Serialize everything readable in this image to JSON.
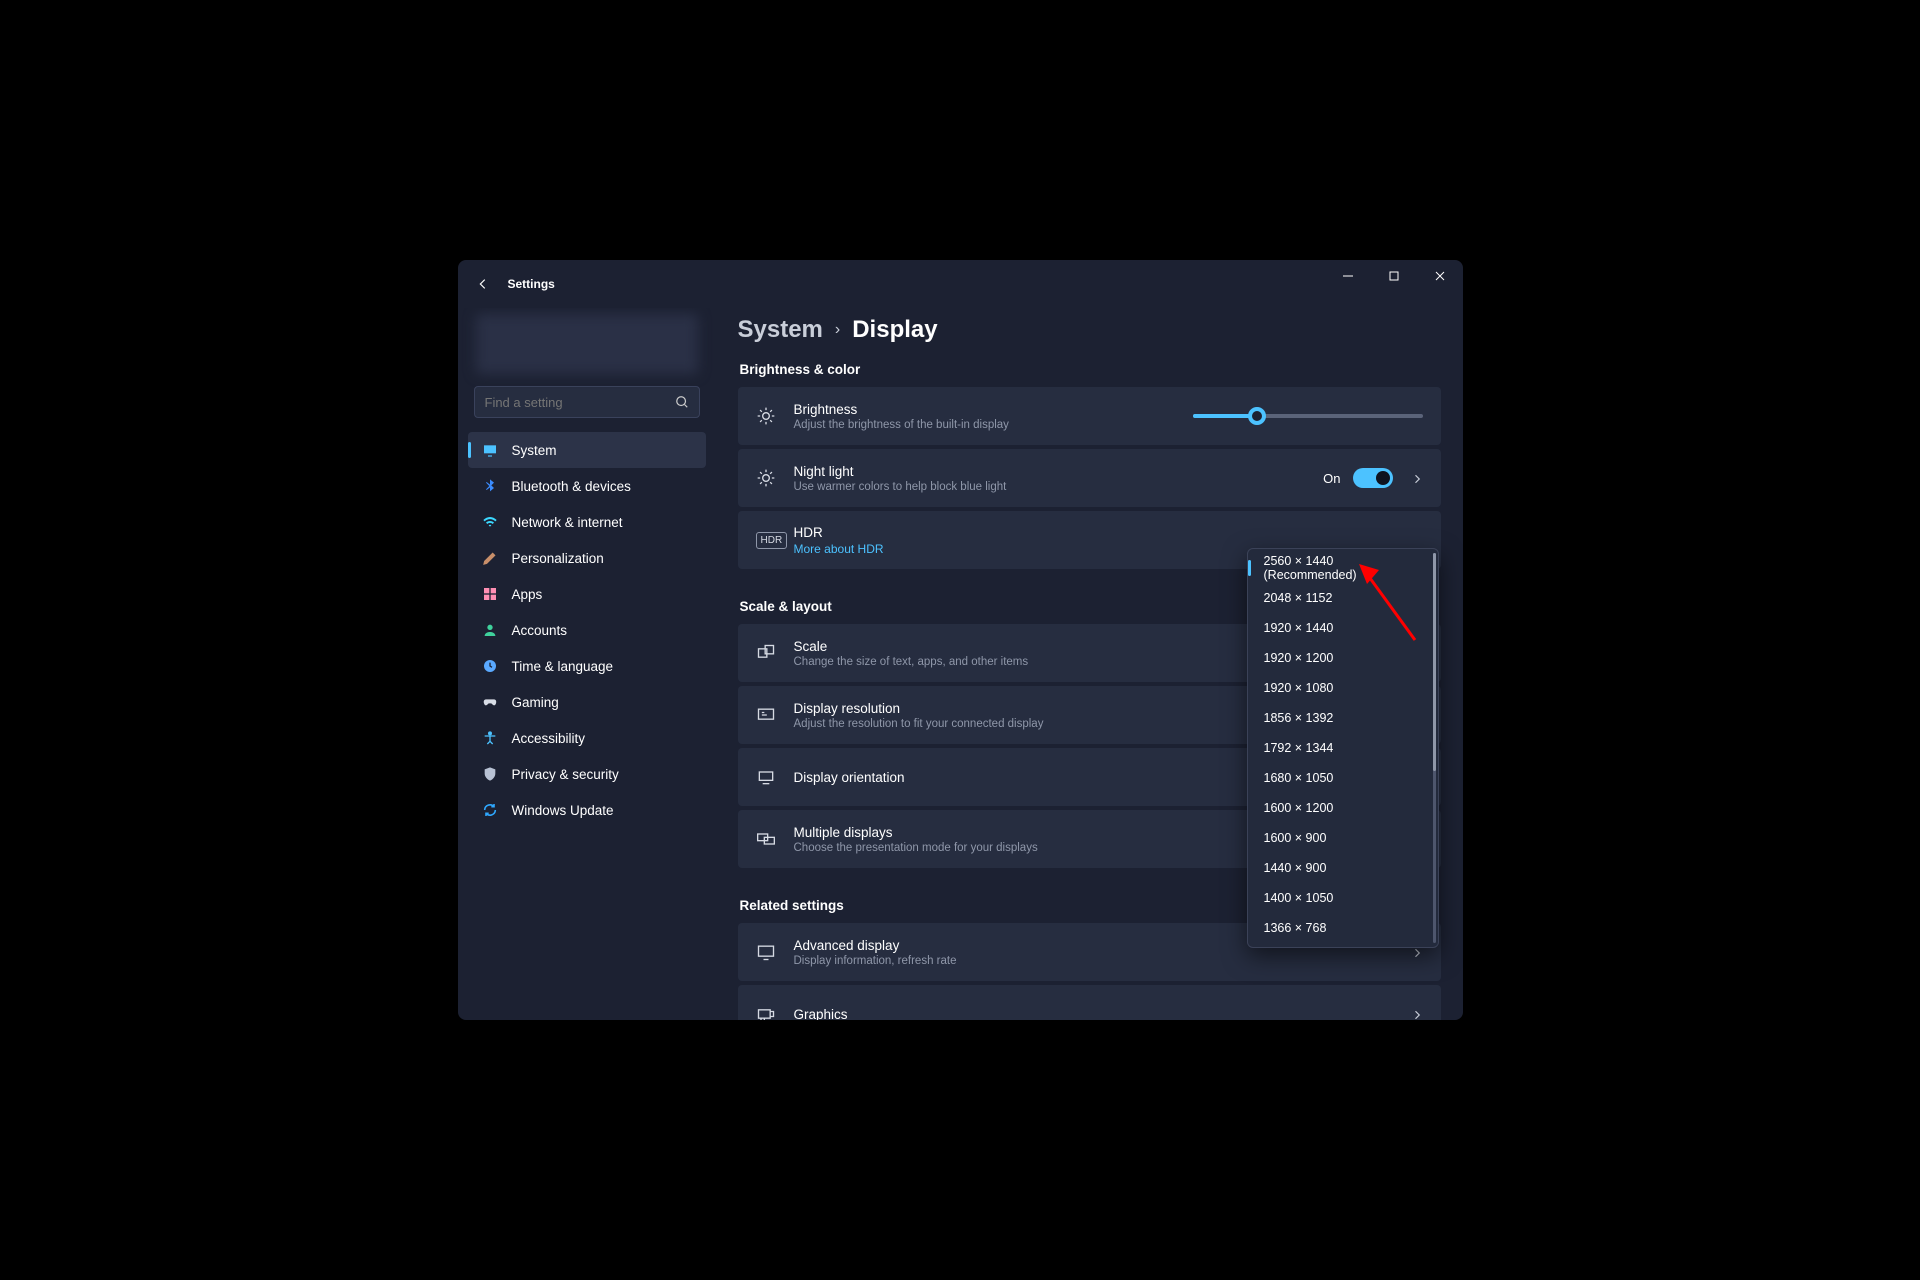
{
  "titlebar": {
    "app_name": "Settings"
  },
  "search": {
    "placeholder": "Find a setting"
  },
  "sidebar": [
    {
      "label": "System",
      "active": true,
      "color": "#4cc2ff"
    },
    {
      "label": "Bluetooth & devices",
      "color": "#3b8cff"
    },
    {
      "label": "Network & internet",
      "color": "#3bd8ff"
    },
    {
      "label": "Personalization",
      "color": "#c88f6a"
    },
    {
      "label": "Apps",
      "color": "#ff8fb3"
    },
    {
      "label": "Accounts",
      "color": "#3fd19c"
    },
    {
      "label": "Time & language",
      "color": "#5aa9ff"
    },
    {
      "label": "Gaming",
      "color": "#d8dde6"
    },
    {
      "label": "Accessibility",
      "color": "#4cc2ff"
    },
    {
      "label": "Privacy & security",
      "color": "#b8c2d4"
    },
    {
      "label": "Windows Update",
      "color": "#2fa8ff"
    }
  ],
  "breadcrumb": {
    "level1": "System",
    "level2": "Display"
  },
  "sections": {
    "brightness_color": "Brightness & color",
    "scale_layout": "Scale & layout",
    "related": "Related settings"
  },
  "cards": {
    "brightness": {
      "title": "Brightness",
      "sub": "Adjust the brightness of the built-in display",
      "slider_pct": 28
    },
    "nightlight": {
      "title": "Night light",
      "sub": "Use warmer colors to help block blue light",
      "toggle_state": "On"
    },
    "hdr": {
      "title": "HDR",
      "link": "More about HDR",
      "badge": "HDR"
    },
    "scale": {
      "title": "Scale",
      "sub": "Change the size of text, apps, and other items"
    },
    "resolution": {
      "title": "Display resolution",
      "sub": "Adjust the resolution to fit your connected display"
    },
    "orientation": {
      "title": "Display orientation"
    },
    "multiple": {
      "title": "Multiple displays",
      "sub": "Choose the presentation mode for your displays"
    },
    "advanced": {
      "title": "Advanced display",
      "sub": "Display information, refresh rate"
    },
    "graphics": {
      "title": "Graphics"
    }
  },
  "resolution_dropdown": {
    "selected": "2560 × 1440 (Recommended)",
    "options": [
      "2560 × 1440 (Recommended)",
      "2048 × 1152",
      "1920 × 1440",
      "1920 × 1200",
      "1920 × 1080",
      "1856 × 1392",
      "1792 × 1344",
      "1680 × 1050",
      "1600 × 1200",
      "1600 × 900",
      "1440 × 900",
      "1400 × 1050",
      "1366 × 768"
    ]
  }
}
